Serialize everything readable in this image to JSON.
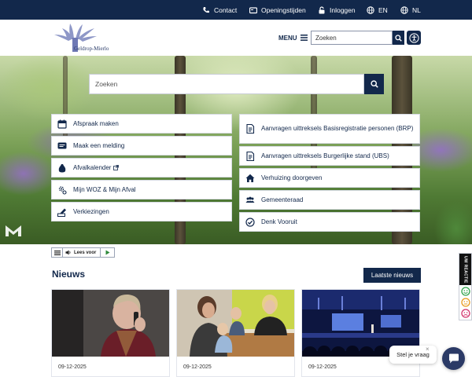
{
  "topbar": {
    "contact": "Contact",
    "hours": "Openingstijden",
    "login": "Inloggen",
    "lang_en": "EN",
    "lang_nl": "NL"
  },
  "header": {
    "logo_text": "Geldrop-Mierlo",
    "menu_label": "MENU",
    "search_placeholder": "Zoeken"
  },
  "hero": {
    "search_placeholder": "Zoeken",
    "tiles_left": [
      {
        "label": "Afspraak maken",
        "icon": "calendar-icon"
      },
      {
        "label": "Maak een melding",
        "icon": "message-icon"
      },
      {
        "label": "Afvalkalender",
        "icon": "bag-icon"
      },
      {
        "label": "Mijn WOZ & Mijn Afval",
        "icon": "settings-user-icon"
      },
      {
        "label": "Verkiezingen",
        "icon": "ballot-icon"
      }
    ],
    "tiles_right": [
      {
        "label": "Aanvragen uittreksels Basisregistratie personen (BRP)",
        "icon": "document-icon"
      },
      {
        "label": "Aanvragen uittreksels Burgerlijke stand (UBS)",
        "icon": "document-icon"
      },
      {
        "label": "Verhuizing doorgeven",
        "icon": "home-icon"
      },
      {
        "label": "Gemeenteraad",
        "icon": "group-icon"
      },
      {
        "label": "Denk Vooruit",
        "icon": "check-circle-icon"
      }
    ]
  },
  "readbar": {
    "label": "Lees voor"
  },
  "news": {
    "title": "Nieuws",
    "button": "Laatste nieuws",
    "items": [
      {
        "date": "09-12-2025"
      },
      {
        "date": "09-12-2025"
      },
      {
        "date": "09-12-2025"
      }
    ]
  },
  "feedback": {
    "label": "UW REACTIE"
  },
  "chat": {
    "prompt": "Stel je vraag",
    "close": "×"
  },
  "colors": {
    "primary": "#12284b",
    "accent_purple": "#8a6fc0"
  }
}
